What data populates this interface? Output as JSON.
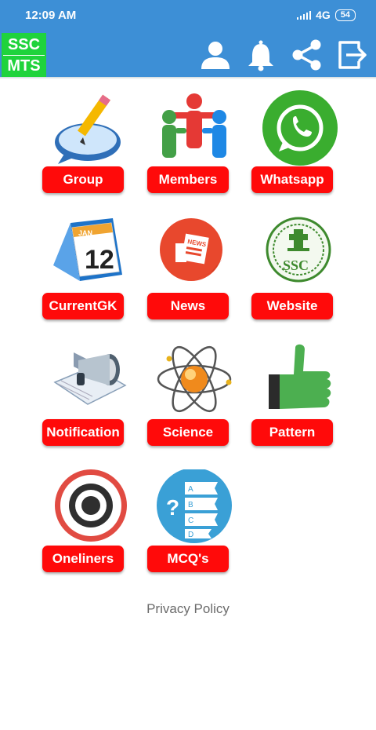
{
  "status": {
    "time": "12:09 AM",
    "network": "4G",
    "battery": "54"
  },
  "app_bar": {
    "logo_line1": "SSC",
    "logo_line2": "MTS",
    "icons": [
      "profile-icon",
      "bell-icon",
      "share-icon",
      "exit-icon"
    ]
  },
  "tiles": [
    {
      "label": "Group",
      "icon": "chat-pencil-icon"
    },
    {
      "label": "Members",
      "icon": "people-icon"
    },
    {
      "label": "Whatsapp",
      "icon": "whatsapp-icon"
    },
    {
      "label": "CurrentGK",
      "icon": "calendar-icon"
    },
    {
      "label": "News",
      "icon": "newspaper-icon"
    },
    {
      "label": "Website",
      "icon": "ssc-emblem-icon"
    },
    {
      "label": "Notification",
      "icon": "megaphone-icon"
    },
    {
      "label": "Science",
      "icon": "atom-icon"
    },
    {
      "label": "Pattern",
      "icon": "thumbs-up-icon"
    },
    {
      "label": "Oneliners",
      "icon": "target-icon"
    },
    {
      "label": "MCQ's",
      "icon": "mcq-icon"
    }
  ],
  "calendar": {
    "month": "JAN",
    "day": "12"
  },
  "news_icon_text": "NEWS",
  "emblem_text": "SSC",
  "mcq_options": [
    "A",
    "B",
    "C",
    "D"
  ],
  "privacy_label": "Privacy Policy",
  "colors": {
    "primary": "#3d8fd6",
    "logo_bg": "#1fd33c",
    "button": "#ff0a0a"
  }
}
